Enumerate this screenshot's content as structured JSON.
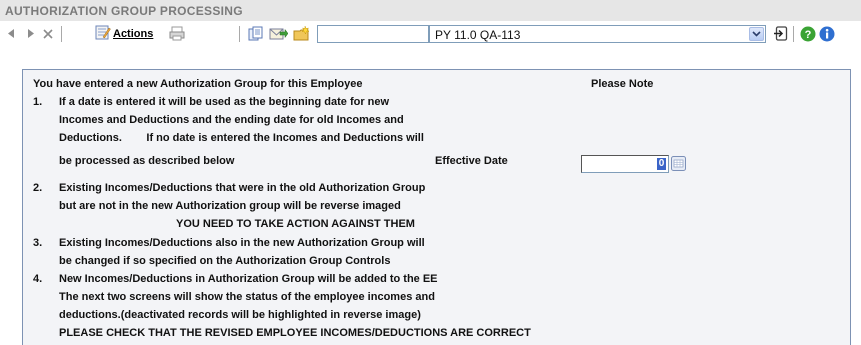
{
  "window": {
    "title": "AUTHORIZATION GROUP PROCESSING"
  },
  "toolbar": {
    "actions_label": "Actions",
    "search_value": "",
    "selected_company": "PY 11.0 QA-113"
  },
  "notice": {
    "intro": "You have entered a new Authorization Group for this Employee",
    "please_note": "Please Note",
    "items": [
      {
        "num": "1.",
        "lines": [
          "If a date is entered it will be used as the beginning date for new",
          "Incomes and Deductions and the ending date for old Incomes and",
          "Deductions.        If no date is entered the Incomes and Deductions will",
          "be processed as described below"
        ]
      },
      {
        "num": "2.",
        "lines": [
          "Existing Incomes/Deductions that were in the old Authorization Group",
          "but are not in the new Authorization group will be reverse imaged",
          "YOU NEED TO TAKE ACTION AGAINST THEM"
        ]
      },
      {
        "num": "3.",
        "lines": [
          "Existing Incomes/Deductions also in the new Authorization Group will",
          "be changed if so specified on the Authorization Group Controls"
        ]
      },
      {
        "num": "4.",
        "lines": [
          "New Incomes/Deductions in Authorization Group will be added to the EE",
          "The next two screens will show the status of the employee incomes and",
          "deductions.(deactivated records will be highlighted in reverse image)",
          "PLEASE CHECK THAT THE REVISED EMPLOYEE INCOMES/DEDUCTIONS ARE CORRECT"
        ]
      }
    ],
    "effective_date_label": "Effective Date",
    "effective_date_value": "0"
  }
}
